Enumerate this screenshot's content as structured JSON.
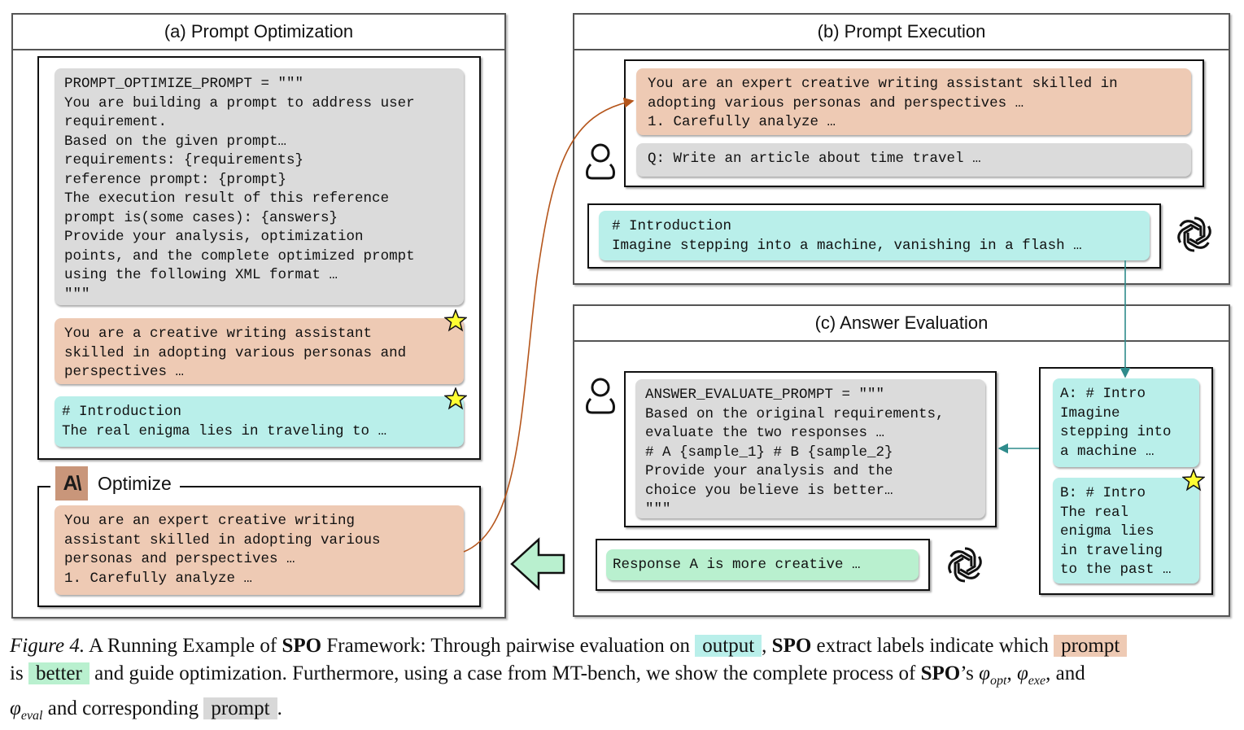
{
  "panels": {
    "a": {
      "title": "(a) Prompt Optimization",
      "optimize_prompt": "PROMPT_OPTIMIZE_PROMPT = \"\"\"\nYou are building a prompt to address user\nrequirement.\nBased on the given prompt…\nrequirements: {requirements}\nreference prompt: {prompt}\nThe execution result of this reference\nprompt is(some cases): {answers}\nProvide your analysis, optimization\npoints, and the complete optimized prompt\nusing the following XML format …\n\"\"\"",
      "best_prompt": "You are a creative writing assistant\nskilled in adopting various personas and\nperspectives …",
      "best_output": "# Introduction\nThe real enigma lies in traveling to …",
      "optimize_label": "Optimize",
      "optimize_logo": "A\\",
      "optimized_prompt": "You are an expert creative writing\nassistant skilled in adopting various\npersonas and perspectives …\n1. Carefully analyze …"
    },
    "b": {
      "title": "(b) Prompt Execution",
      "prompt": "You are an expert creative writing assistant skilled in\nadopting various personas and perspectives …\n1. Carefully analyze …",
      "question": "Q: Write an article about time travel …",
      "output": "# Introduction\nImagine stepping into a machine, vanishing in a flash …"
    },
    "c": {
      "title": "(c) Answer Evaluation",
      "eval_prompt": "ANSWER_EVALUATE_PROMPT = \"\"\"\nBased on the original requirements,\nevaluate the two responses …\n# A {sample_1} # B {sample_2}\nProvide your analysis and the\nchoice you believe is better…\n\"\"\"",
      "verdict": "Response A is more creative …",
      "answer_a": "A: # Intro\nImagine\nstepping into\na machine …",
      "answer_b": "B: # Intro\nThe real\nenigma lies\nin traveling\nto the past …"
    }
  },
  "icons": {
    "user": "user-icon",
    "llm": "openai-logo-icon",
    "anthropic": "anthropic-logo-icon",
    "star": "star-icon",
    "arrow": "left-arrow-icon"
  },
  "colors": {
    "prompt": "#eecab4",
    "output": "#b9efea",
    "better": "#b9f0cf",
    "template": "#dbdbdb",
    "star": "#ffff33",
    "flow_prompt": "#b5561c",
    "flow_output": "#2e8b8b"
  },
  "caption": {
    "fig_label": "Figure 4.",
    "t1": " A Running Example of ",
    "spo1": "SPO",
    "t2": " Framework: Through pairwise evaluation on ",
    "hl_output": "output",
    "t3": ", ",
    "spo2": "SPO",
    "t4": " extract labels indicate which ",
    "hl_prompt": "prompt",
    "t5": "is ",
    "hl_better": "better",
    "t6": " and guide optimization. Furthermore, using a case from MT-bench, we show the complete process of ",
    "spo3": "SPO",
    "t7": "’s ",
    "phi": "φ",
    "sub_opt": "opt",
    "sub_exe": "exe",
    "sub_eval": "eval",
    "t8": ", and",
    "t9": " and corresponding ",
    "hl_prompt2": "prompt",
    "t10": "."
  }
}
